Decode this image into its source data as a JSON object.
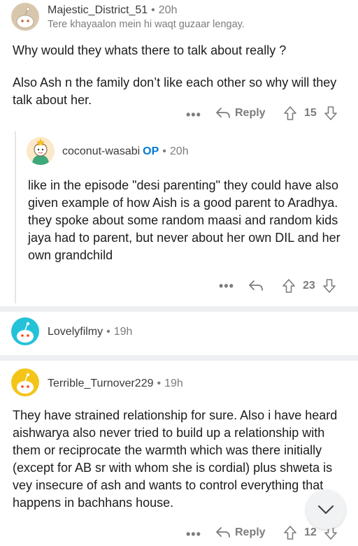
{
  "comments": [
    {
      "user": "Majestic_District_51",
      "time": "20h",
      "flair": "Tere khayaalon mein hi waqt guzaar lengay.",
      "body": [
        "Why would they whats there to talk about really ?",
        "Also Ash n the family don’t like each other so why will they talk about her."
      ],
      "reply_label": "Reply",
      "score": "15"
    },
    {
      "user": "coconut-wasabi",
      "op_badge": "OP",
      "time": "20h",
      "body": [
        "like in the episode \"desi parenting\" they could have also given example of how Aish is a good parent to Aradhya. they spoke about some random maasi and random kids jaya had to parent, but never about her own DIL and her own grandchild"
      ],
      "score": "23"
    },
    {
      "user": "Lovelyfilmy",
      "time": "19h"
    },
    {
      "user": "Terrible_Turnover229",
      "time": "19h",
      "body": [
        "They have strained relationship for sure. Also i have heard aishwarya also never tried to build up a relationship with them or reciprocate the warmth which was there initially (except for AB sr with whom she is cordial) plus shweta is vey insecure of ash and wants to control everything that happens in bachhans house."
      ],
      "reply_label": "Reply",
      "score": "12"
    }
  ],
  "more_label": "•••",
  "dot": "•",
  "colors": {
    "text": "#1c1c1c",
    "meta": "#7c7c7c",
    "op": "#0079d3",
    "divider": "#edeff1",
    "avatar_teal": "#24c2d8",
    "avatar_yellow": "#f4c518",
    "avatar_beige": "#d9c7ad"
  },
  "icons": [
    "snoo-avatar-icon",
    "reply-arrow-icon",
    "upvote-arrow-icon",
    "downvote-arrow-icon",
    "chevron-down-icon",
    "more-dots-icon"
  ]
}
